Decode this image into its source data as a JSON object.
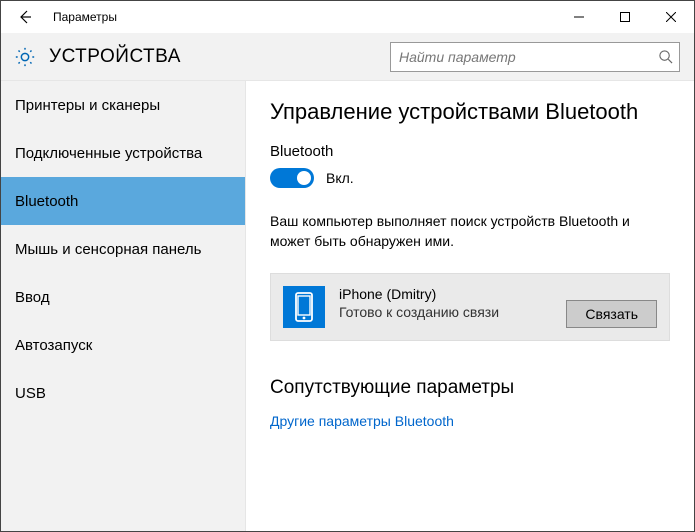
{
  "window": {
    "title": "Параметры"
  },
  "header": {
    "section": "УСТРОЙСТВА",
    "search_placeholder": "Найти параметр"
  },
  "sidebar": {
    "items": [
      {
        "label": "Принтеры и сканеры"
      },
      {
        "label": "Подключенные устройства"
      },
      {
        "label": "Bluetooth"
      },
      {
        "label": "Мышь и сенсорная панель"
      },
      {
        "label": "Ввод"
      },
      {
        "label": "Автозапуск"
      },
      {
        "label": "USB"
      }
    ]
  },
  "main": {
    "title": "Управление устройствами Bluetooth",
    "toggle_label": "Bluetooth",
    "toggle_state": "Вкл.",
    "description": "Ваш компьютер выполняет поиск устройств Bluetooth и может быть обнаружен ими.",
    "device": {
      "name": "iPhone (Dmitry)",
      "status": "Готово к созданию связи",
      "pair_button": "Связать"
    },
    "related_heading": "Сопутствующие параметры",
    "related_link": "Другие параметры Bluetooth"
  }
}
